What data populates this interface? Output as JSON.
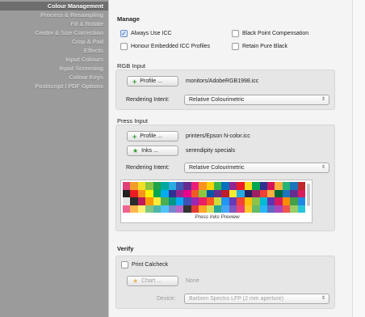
{
  "sidebar": {
    "items": [
      {
        "label": "Colour Management"
      },
      {
        "label": "Process & Resampling"
      },
      {
        "label": "Fit & Rotate"
      },
      {
        "label": "Centre & Size Correction"
      },
      {
        "label": "Crop & Pad"
      },
      {
        "label": "Effects"
      },
      {
        "label": "Input Colours"
      },
      {
        "label": "Input Screening"
      },
      {
        "label": "Colour Keys"
      },
      {
        "label": "Postscript / PDF Options"
      }
    ]
  },
  "manage": {
    "title": "Manage",
    "always_use_icc": {
      "label": "Always Use ICC",
      "checked": true
    },
    "black_point": {
      "label": "Black Point Compensation",
      "checked": false
    },
    "honour_embedded": {
      "label": "Honour Embedded ICC Profiles",
      "checked": false
    },
    "retain_black": {
      "label": "Retain Pure Black",
      "checked": false
    }
  },
  "rgb_input": {
    "title": "RGB Input",
    "profile_button": "Profile ...",
    "profile_value": "monitors/AdobeRGB1998.icc",
    "intent_label": "Rendering Intent:",
    "intent_value": "Relative Colourimetric"
  },
  "press_input": {
    "title": "Press Input",
    "profile_button": "Profile ...",
    "profile_value": "printers/Epson N-color.icc",
    "inks_button": "Inks ...",
    "inks_value": "serendipity specials",
    "intent_label": "Rendering Intent:",
    "intent_value": "Relative Colourimetric",
    "preview_caption": "Press Inks Preview",
    "swatches": [
      "#e0407a",
      "#f39c2a",
      "#f2e024",
      "#8cc63f",
      "#1ea34a",
      "#00a99d",
      "#29abe2",
      "#3b5cb8",
      "#662d91",
      "#ec1e79",
      "#f7931e",
      "#ffd400",
      "#39b54a",
      "#0071bc",
      "#93278f",
      "#ed1c24",
      "#ffde17",
      "#00a651",
      "#2e3192",
      "#d4145a",
      "#fbb03b",
      "#22b573",
      "#1b75bc",
      "#c1272d",
      "#231f20",
      "#ed1c24",
      "#f7941d",
      "#fff200",
      "#00a651",
      "#00aeef",
      "#2e3192",
      "#92278f",
      "#ec008c",
      "#f15a24",
      "#8dc63f",
      "#0054a6",
      "#662d91",
      "#be1e2d",
      "#f9ed32",
      "#27aae1",
      "#262262",
      "#9e1f63",
      "#ef4136",
      "#fbb040",
      "#006838",
      "#1c75bc",
      "#652d90",
      "#da1c5c",
      "#e6e6e6",
      "#2b2b2b",
      "#c2185b",
      "#ff9800",
      "#ffeb3b",
      "#4caf50",
      "#009688",
      "#03a9f4",
      "#3f51b5",
      "#9c27b0",
      "#e91e63",
      "#ff5722",
      "#cddc39",
      "#2196f3",
      "#673ab7",
      "#f44336",
      "#ffc107",
      "#8bc34a",
      "#00bcd4",
      "#5e35b1",
      "#d81b60",
      "#fb8c00",
      "#43a047",
      "#1e88e5",
      "#f06292",
      "#ffb74d",
      "#fff176",
      "#81c784",
      "#4db6ac",
      "#4fc3f7",
      "#7986cb",
      "#ba68c8",
      "#333333",
      "#e53935",
      "#ffa726",
      "#d4e157",
      "#26a69a",
      "#42a5f5",
      "#7e57c2",
      "#ec407a",
      "#ffca28",
      "#66bb6a",
      "#29b6f6",
      "#5c6bc0",
      "#ab47bc",
      "#ef5350",
      "#9ccc65",
      "#26c6da"
    ]
  },
  "verify": {
    "title": "Verify",
    "print_calcheck": {
      "label": "Print Calcheck",
      "checked": false
    },
    "chart_button": "Chart ...",
    "chart_value": "None",
    "device_label": "Device:",
    "device_value": "Barbieri Spectro LFP (2 mm aperture)"
  }
}
